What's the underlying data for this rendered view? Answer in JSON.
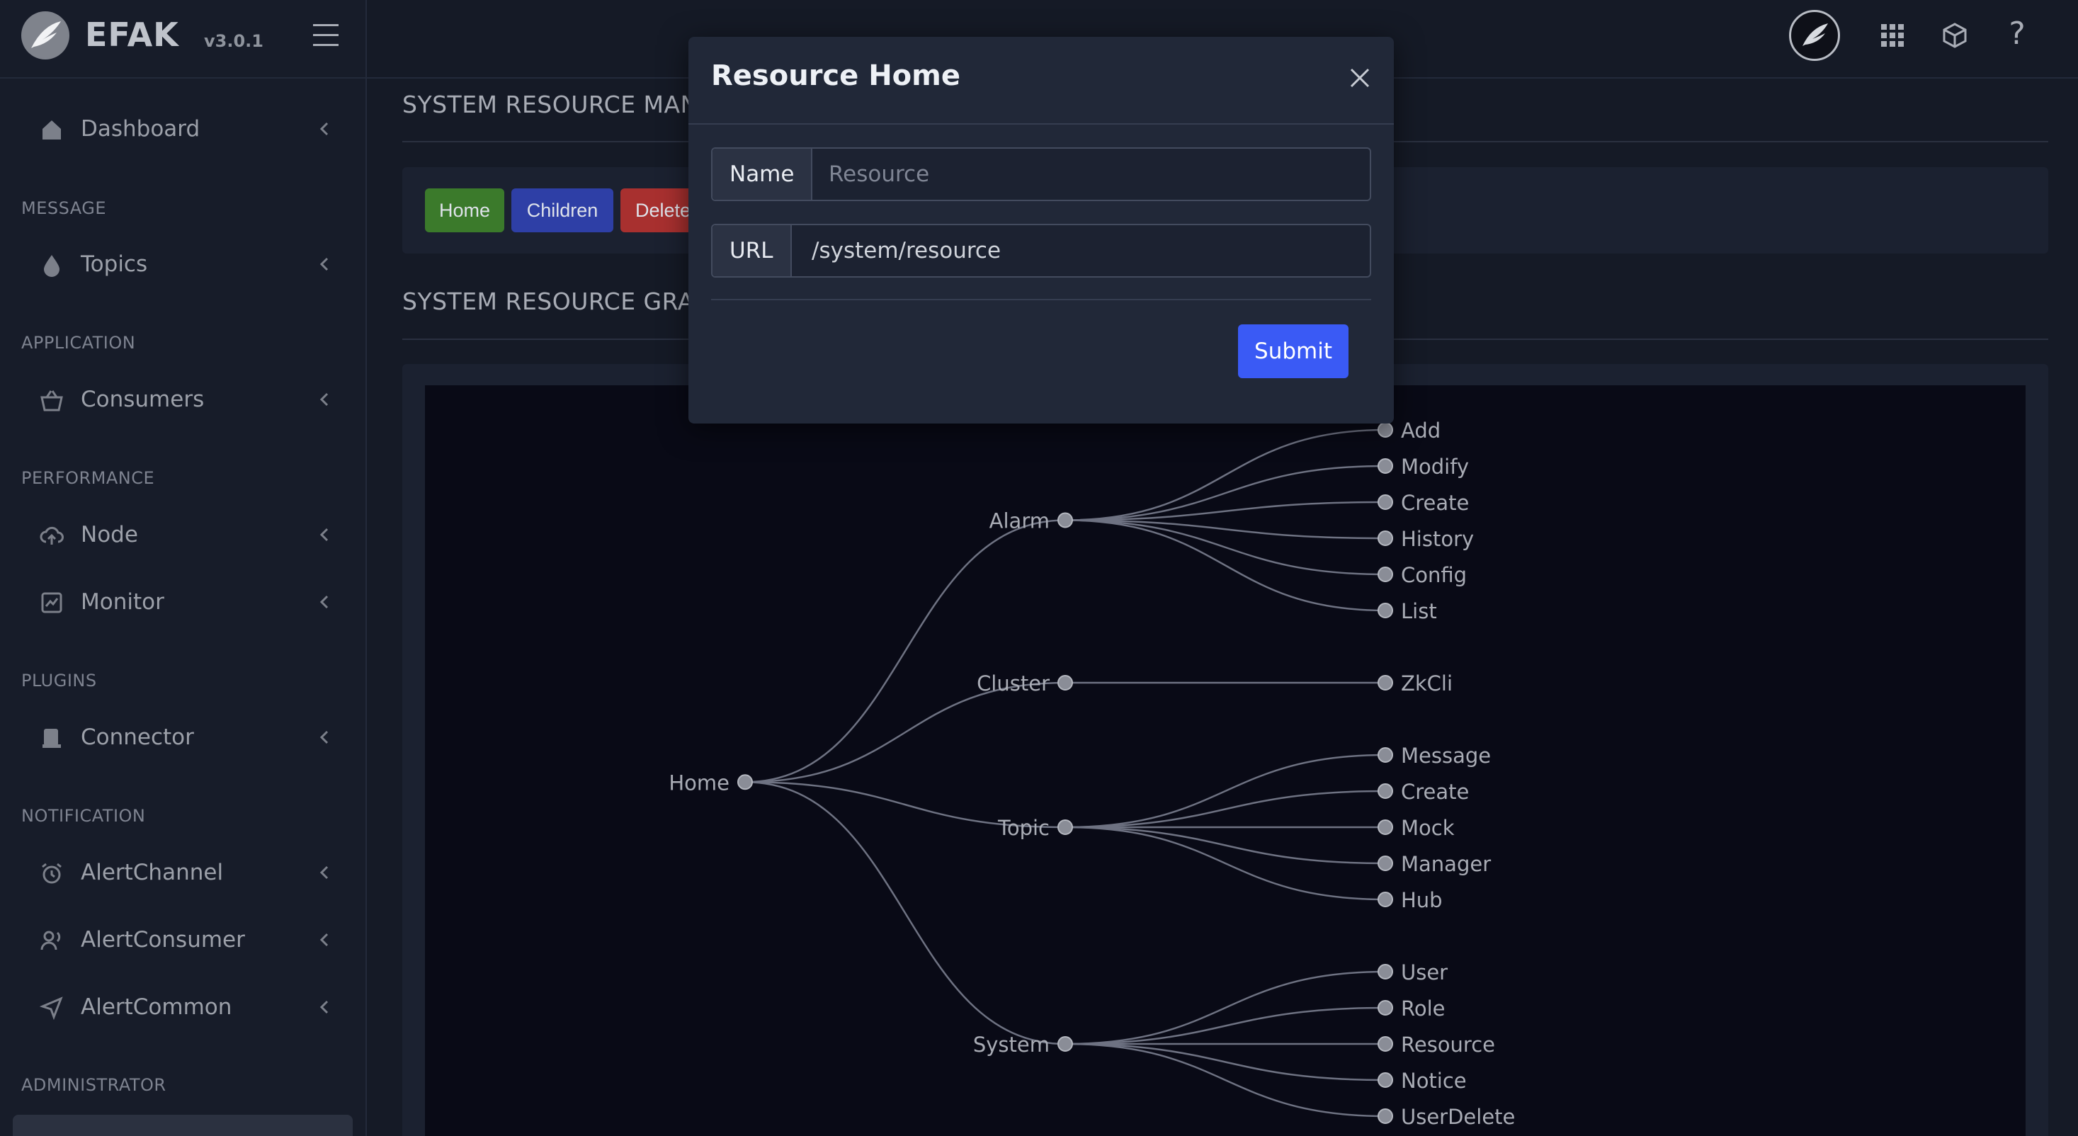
{
  "brand": {
    "name": "EFAK",
    "version": "v3.0.1"
  },
  "sidebar": {
    "sections": [
      {
        "heading": "",
        "items": [
          {
            "label": "Dashboard",
            "icon": "home-icon"
          }
        ]
      },
      {
        "heading": "MESSAGE",
        "items": [
          {
            "label": "Topics",
            "icon": "droplet-icon"
          }
        ]
      },
      {
        "heading": "APPLICATION",
        "items": [
          {
            "label": "Consumers",
            "icon": "basket-icon"
          }
        ]
      },
      {
        "heading": "PERFORMANCE",
        "items": [
          {
            "label": "Node",
            "icon": "cloud-upload-icon"
          },
          {
            "label": "Monitor",
            "icon": "line-chart-icon"
          }
        ]
      },
      {
        "heading": "PLUGINS",
        "items": [
          {
            "label": "Connector",
            "icon": "plug-icon"
          }
        ]
      },
      {
        "heading": "NOTIFICATION",
        "items": [
          {
            "label": "AlertChannel",
            "icon": "alarm-clock-icon"
          },
          {
            "label": "AlertConsumer",
            "icon": "user-voice-icon"
          },
          {
            "label": "AlertCommon",
            "icon": "send-icon"
          }
        ]
      },
      {
        "heading": "ADMINISTRATOR",
        "items": []
      }
    ]
  },
  "topbar": {
    "icons": [
      "avatar",
      "apps-grid-icon",
      "cube-icon",
      "help-icon"
    ],
    "help_label": "?"
  },
  "main": {
    "management_title": "SYSTEM RESOURCE MANAGEMENT",
    "graph_title": "SYSTEM RESOURCE GRAPH",
    "toolbar": {
      "home_label": "Home",
      "children_label": "Children",
      "delete_label": "Delete"
    },
    "colors": {
      "home": "#3b7a2b",
      "children": "#2e3fa6",
      "delete": "#a8302f"
    }
  },
  "tree": {
    "label": "Home",
    "children": [
      {
        "label": "Alarm",
        "children": [
          "Add",
          "Modify",
          "Create",
          "History",
          "Config",
          "List"
        ]
      },
      {
        "label": "Cluster",
        "children": [
          "ZkCli"
        ]
      },
      {
        "label": "Topic",
        "children": [
          "Message",
          "Create",
          "Mock",
          "Manager",
          "Hub"
        ]
      },
      {
        "label": "System",
        "children": [
          "User",
          "Role",
          "Resource",
          "Notice",
          "UserDelete"
        ]
      }
    ]
  },
  "modal": {
    "title": "Resource Home",
    "name_label": "Name",
    "name_placeholder": "Resource",
    "url_label": "URL",
    "url_value": "/system/resource",
    "submit_label": "Submit"
  }
}
